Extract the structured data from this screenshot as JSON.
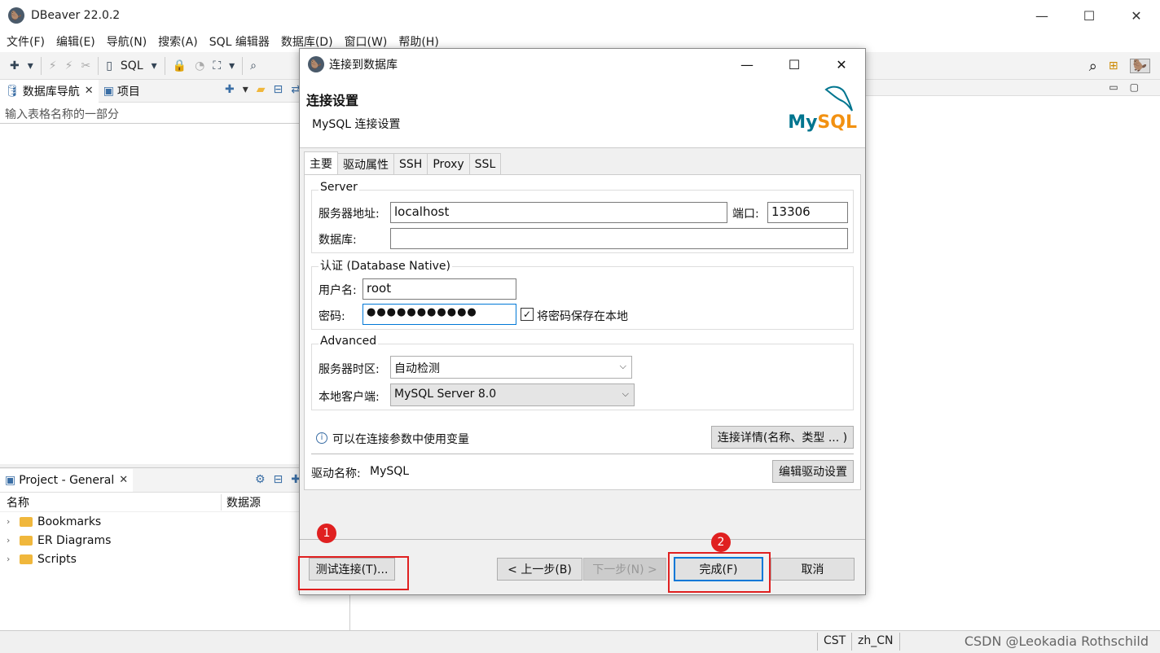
{
  "app": {
    "title": "DBeaver 22.0.2"
  },
  "menu": [
    "文件(F)",
    "编辑(E)",
    "导航(N)",
    "搜索(A)",
    "SQL 编辑器",
    "数据库(D)",
    "窗口(W)",
    "帮助(H)"
  ],
  "toolbar": {
    "sql_label": "SQL"
  },
  "navigator": {
    "tab_db": "数据库导航",
    "tab_project": "项目",
    "filter_placeholder": "输入表格名称的一部分"
  },
  "project": {
    "tab": "Project - General",
    "col_name": "名称",
    "col_source": "数据源",
    "items": [
      "Bookmarks",
      "ER Diagrams",
      "Scripts"
    ]
  },
  "status": {
    "tz": "CST",
    "locale": "zh_CN",
    "watermark": "CSDN @Leokadia Rothschild"
  },
  "dialog": {
    "title": "连接到数据库",
    "heading": "连接设置",
    "subheading": "MySQL 连接设置",
    "logo_my": "My",
    "logo_sql": "SQL",
    "tabs": [
      "主要",
      "驱动属性",
      "SSH",
      "Proxy",
      "SSL"
    ],
    "server": {
      "group": "Server",
      "host_label": "服务器地址:",
      "host_value": "localhost",
      "port_label": "端口:",
      "port_value": "13306",
      "db_label": "数据库:",
      "db_value": ""
    },
    "auth": {
      "group": "认证 (Database Native)",
      "user_label": "用户名:",
      "user_value": "root",
      "pass_label": "密码:",
      "pass_value": "●●●●●●●●●●●",
      "save_label": "将密码保存在本地",
      "save_checked": "✓"
    },
    "advanced": {
      "group": "Advanced",
      "tz_label": "服务器时区:",
      "tz_value": "自动检测",
      "client_label": "本地客户端:",
      "client_value": "MySQL Server 8.0"
    },
    "info_text": "可以在连接参数中使用变量",
    "details_button": "连接详情(名称、类型 ... )",
    "driver_label": "驱动名称:",
    "driver_value": "MySQL",
    "edit_driver_button": "编辑驱动设置",
    "buttons": {
      "test": "测试连接(T)...",
      "back": "< 上一步(B)",
      "next": "下一步(N) >",
      "finish": "完成(F)",
      "cancel": "取消"
    },
    "badges": [
      "1",
      "2"
    ]
  }
}
